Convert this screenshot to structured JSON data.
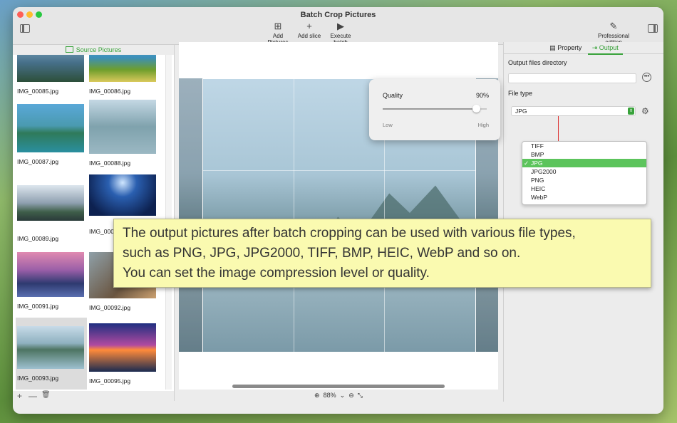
{
  "window": {
    "title": "Batch Crop Pictures",
    "traffic_colors": [
      "#fe5f57",
      "#febc2e",
      "#28c840"
    ]
  },
  "toolbar": {
    "add_pictures": "Add Pictures",
    "add_slice": "Add slice",
    "execute_batch": "Execute batch",
    "professional": "Professional edition"
  },
  "left": {
    "header": "Source Pictures",
    "thumbs": [
      {
        "name": "IMG_00085.jpg"
      },
      {
        "name": "IMG_00086.jpg"
      },
      {
        "name": "IMG_00087.jpg"
      },
      {
        "name": "IMG_00088.jpg"
      },
      {
        "name": "IMG_00089.jpg"
      },
      {
        "name": "IMG_000"
      },
      {
        "name": "IMG_00091.jpg"
      },
      {
        "name": "IMG_00092.jpg"
      },
      {
        "name": "IMG_00093.jpg"
      },
      {
        "name": "IMG_00095.jpg"
      }
    ],
    "footer": {
      "add": "+",
      "remove": "—",
      "trash": "🗑"
    }
  },
  "center": {
    "zoom": "88%"
  },
  "right": {
    "tabs": {
      "property": "Property",
      "output": "Output"
    },
    "output_dir_label": "Output files directory",
    "file_type_label": "File type",
    "file_type_value": "JPG",
    "options": [
      "TIFF",
      "BMP",
      "JPG",
      "JPG2000",
      "PNG",
      "HEIC",
      "WebP"
    ],
    "selected_option": "JPG"
  },
  "quality": {
    "label": "Quality",
    "value_text": "90%",
    "value": 0.9,
    "low": "Low",
    "high": "High"
  },
  "banner": {
    "line1": "The output pictures after batch cropping can be used with various file types,",
    "line2": "such as PNG, JPG, JPG2000, TIFF, BMP, HEIC, WebP and so on.",
    "line3": "You can set the image compression level or quality."
  },
  "colors": {
    "accent": "#38a23a",
    "banner_bg": "#fafab0"
  }
}
